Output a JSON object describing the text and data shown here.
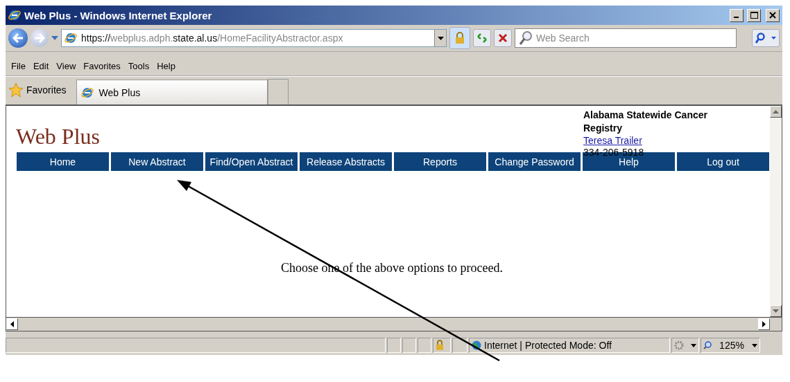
{
  "window": {
    "title": "Web Plus - Windows Internet Explorer"
  },
  "address_bar": {
    "url_parts": [
      {
        "text": "https://",
        "dark": true
      },
      {
        "text": "webplus.adph.",
        "dark": false
      },
      {
        "text": "state.al.us",
        "dark": true
      },
      {
        "text": "/HomeFacilityAbstractor.aspx",
        "dark": false
      }
    ]
  },
  "search": {
    "placeholder": "Web Search"
  },
  "menu": [
    "File",
    "Edit",
    "View",
    "Favorites",
    "Tools",
    "Help"
  ],
  "favorites_bar": {
    "label": "Favorites",
    "tabs": [
      {
        "label": "Web Plus",
        "selected": true
      }
    ]
  },
  "page": {
    "site_title": "Web Plus",
    "org": "Alabama Statewide Cancer Registry",
    "user_link": "Teresa Trailer",
    "phone": "334-206-5918",
    "nav": [
      "Home",
      "New Abstract",
      "Find/Open Abstract",
      "Release Abstracts",
      "Reports",
      "Change Password",
      "Help",
      "Log out"
    ],
    "message": "Choose one of the above options to proceed."
  },
  "status_bar": {
    "zone": "Internet | Protected Mode: Off",
    "zoom": "125%"
  }
}
